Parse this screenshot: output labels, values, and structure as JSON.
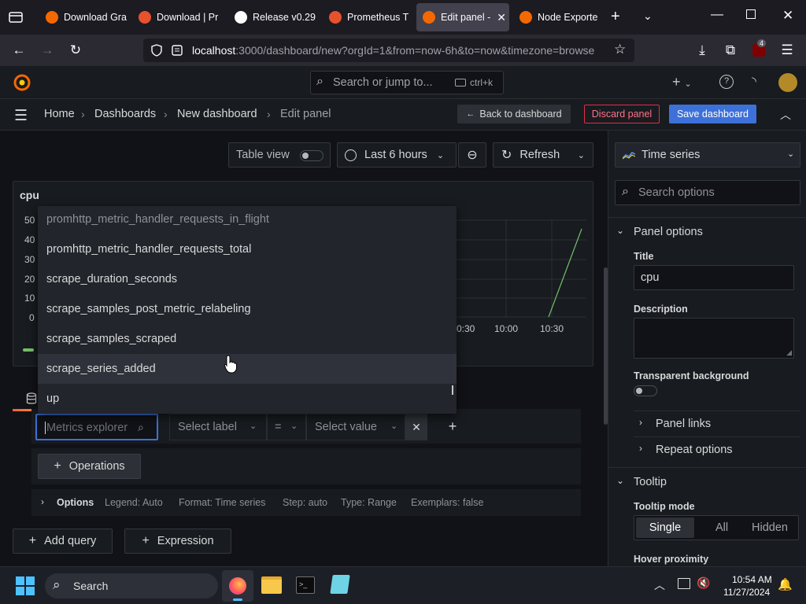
{
  "browser": {
    "tabs": [
      {
        "label": "Download Gra",
        "color": "#f46800"
      },
      {
        "label": "Download | Pr",
        "color": "#e6522c"
      },
      {
        "label": "Release v0.29.",
        "color": "#ffffff"
      },
      {
        "label": "Prometheus T",
        "color": "#e6522c"
      },
      {
        "label": "Edit panel -",
        "color": "#f46800"
      },
      {
        "label": "Node Exporte",
        "color": "#f46800"
      }
    ],
    "url_host": "localhost",
    "url_rest": ":3000/dashboard/new?orgId=1&from=now-6h&to=now&timezone=browse",
    "extension_badge": "4"
  },
  "grafana": {
    "search_placeholder": "Search or jump to...",
    "search_shortcut": "ctrl+k",
    "breadcrumb": [
      "Home",
      "Dashboards",
      "New dashboard",
      "Edit panel"
    ],
    "back_label": "Back to dashboard",
    "discard_label": "Discard panel",
    "save_label": "Save dashboard",
    "toolbar": {
      "table_view": "Table view",
      "time_range": "Last 6 hours",
      "refresh": "Refresh"
    },
    "panel": {
      "title": "cpu",
      "y_ticks": [
        "50",
        "40",
        "30",
        "20",
        "10",
        "0"
      ],
      "x_ticks": [
        "10:00",
        "10:30"
      ],
      "x_tick_partial": "0:30"
    },
    "metrics_dropdown": [
      "promhttp_metric_handler_requests_in_flight",
      "promhttp_metric_handler_requests_total",
      "scrape_duration_seconds",
      "scrape_samples_post_metric_relabeling",
      "scrape_samples_scraped",
      "scrape_series_added",
      "up"
    ],
    "query": {
      "metrics_placeholder": "Metrics explorer",
      "label_placeholder": "Select label",
      "operator": "=",
      "value_placeholder": "Select value",
      "operations": "Operations",
      "options_label": "Options",
      "options_summary": [
        "Legend: Auto",
        "Format: Time series",
        "Step: auto",
        "Type: Range",
        "Exemplars: false"
      ],
      "add_query": "Add query",
      "expression": "Expression"
    },
    "right": {
      "viz": "Time series",
      "search_placeholder": "Search options",
      "panel_options": "Panel options",
      "title_label": "Title",
      "title_value": "cpu",
      "description_label": "Description",
      "transparent_label": "Transparent background",
      "panel_links": "Panel links",
      "repeat_options": "Repeat options",
      "tooltip": "Tooltip",
      "tooltip_mode": "Tooltip mode",
      "tooltip_modes": [
        "Single",
        "All",
        "Hidden"
      ],
      "hover_proximity": "Hover proximity"
    }
  },
  "taskbar": {
    "search": "Search",
    "time": "10:54 AM",
    "date": "11/27/2024"
  },
  "colors": {
    "accent": "#3d71d9",
    "discard": "#e02f44",
    "series": "#73bf69"
  }
}
